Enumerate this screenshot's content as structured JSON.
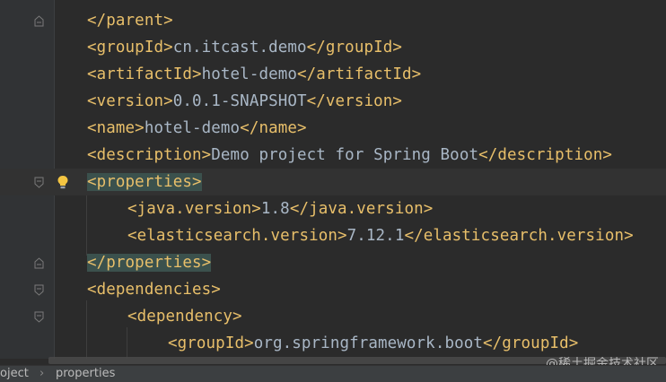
{
  "colors": {
    "background": "#2b2b2b",
    "tag": "#e8bf6a",
    "text": "#a9b7c6",
    "tag_highlight": "#3b514d"
  },
  "lines": [
    {
      "indent": 0,
      "parts": [
        {
          "t": "tag",
          "v": "</parent>"
        }
      ]
    },
    {
      "indent": 0,
      "parts": [
        {
          "t": "tag",
          "v": "<groupId>"
        },
        {
          "t": "text",
          "v": "cn.itcast.demo"
        },
        {
          "t": "tag",
          "v": "</groupId>"
        }
      ]
    },
    {
      "indent": 0,
      "parts": [
        {
          "t": "tag",
          "v": "<artifactId>"
        },
        {
          "t": "text",
          "v": "hotel-demo"
        },
        {
          "t": "tag",
          "v": "</artifactId>"
        }
      ]
    },
    {
      "indent": 0,
      "parts": [
        {
          "t": "tag",
          "v": "<version>"
        },
        {
          "t": "text",
          "v": "0.0.1-SNAPSHOT"
        },
        {
          "t": "tag",
          "v": "</version>"
        }
      ]
    },
    {
      "indent": 0,
      "parts": [
        {
          "t": "tag",
          "v": "<name>"
        },
        {
          "t": "text",
          "v": "hotel-demo"
        },
        {
          "t": "tag",
          "v": "</name>"
        }
      ]
    },
    {
      "indent": 0,
      "parts": [
        {
          "t": "tag",
          "v": "<description>"
        },
        {
          "t": "text",
          "v": "Demo project for Spring Boot"
        },
        {
          "t": "tag",
          "v": "</description>"
        }
      ]
    },
    {
      "indent": 0,
      "parts": [
        {
          "t": "tag-hl",
          "v": "<properties>"
        }
      ]
    },
    {
      "indent": 1,
      "parts": [
        {
          "t": "tag",
          "v": "<java.version>"
        },
        {
          "t": "text",
          "v": "1.8"
        },
        {
          "t": "tag",
          "v": "</java.version>"
        }
      ]
    },
    {
      "indent": 1,
      "parts": [
        {
          "t": "tag",
          "v": "<elasticsearch.version>"
        },
        {
          "t": "text",
          "v": "7.12.1"
        },
        {
          "t": "tag",
          "v": "</elasticsearch.version>"
        }
      ]
    },
    {
      "indent": 0,
      "parts": [
        {
          "t": "tag-hl",
          "v": "</properties>"
        }
      ]
    },
    {
      "indent": 0,
      "parts": [
        {
          "t": "tag",
          "v": "<dependencies>"
        }
      ]
    },
    {
      "indent": 1,
      "parts": [
        {
          "t": "tag",
          "v": "<dependency>"
        }
      ]
    },
    {
      "indent": 2,
      "parts": [
        {
          "t": "tag",
          "v": "<groupId>"
        },
        {
          "t": "text",
          "v": "org.springframework.boot"
        },
        {
          "t": "tag",
          "v": "</groupId>"
        }
      ]
    }
  ],
  "breadcrumb": [
    "oject",
    "properties"
  ],
  "watermark": "@稀土掘金技术社区",
  "icons": {
    "intention": "lightbulb-icon",
    "fold": "fold-marker-icon"
  }
}
